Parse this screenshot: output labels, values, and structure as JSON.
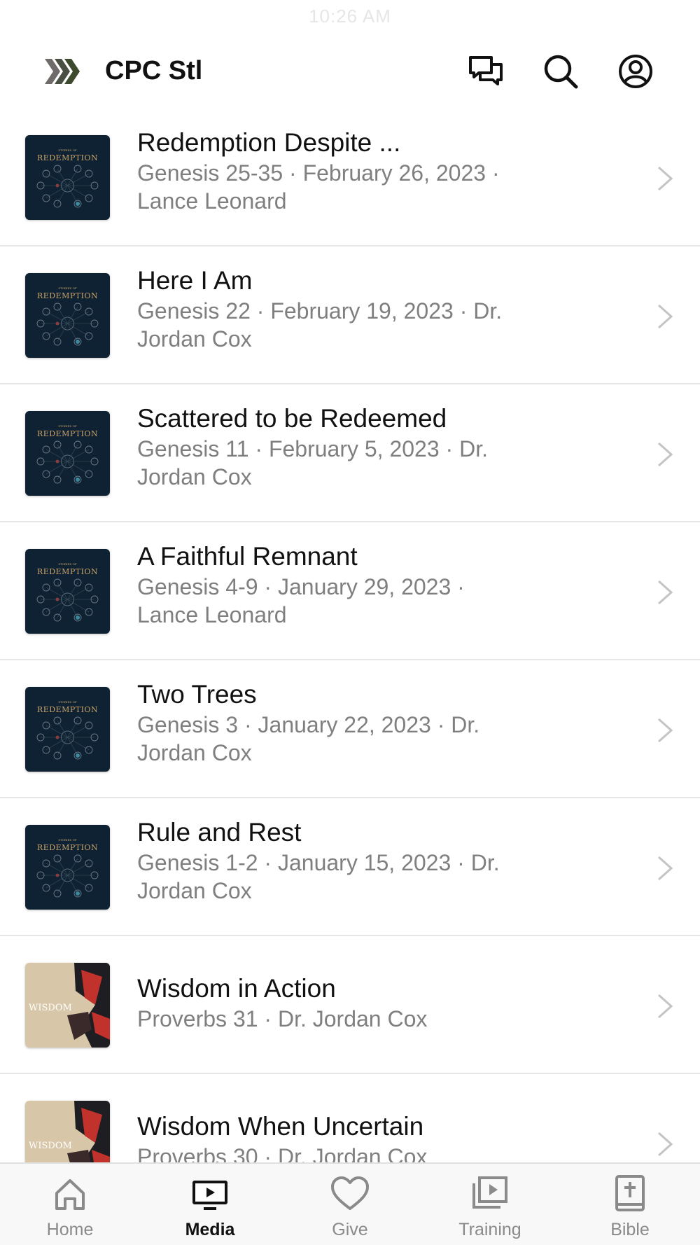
{
  "status_bar": {
    "time": "10:26 AM"
  },
  "header": {
    "title": "CPC Stl",
    "logo_icon": "chevron-logo-icon",
    "actions": [
      "chat-icon",
      "search-icon",
      "profile-icon"
    ]
  },
  "sermons": [
    {
      "title": "Redemption Despite ...",
      "meta_line1": "Genesis 25-35 · February 26, 2023 ·",
      "meta_line2": "Lance Leonard",
      "artwork": "redemption",
      "artwork_text": "REDEMPTION"
    },
    {
      "title": "Here I Am",
      "meta_line1": "Genesis 22 · February 19, 2023 · Dr.",
      "meta_line2": "Jordan Cox",
      "artwork": "redemption",
      "artwork_text": "REDEMPTION"
    },
    {
      "title": "Scattered to be Redeemed",
      "meta_line1": "Genesis 11 · February 5, 2023 · Dr.",
      "meta_line2": "Jordan Cox",
      "artwork": "redemption",
      "artwork_text": "REDEMPTION"
    },
    {
      "title": "A Faithful Remnant",
      "meta_line1": "Genesis 4-9 · January 29, 2023 ·",
      "meta_line2": "Lance Leonard",
      "artwork": "redemption",
      "artwork_text": "REDEMPTION"
    },
    {
      "title": "Two Trees",
      "meta_line1": "Genesis 3 · January 22, 2023 · Dr.",
      "meta_line2": "Jordan Cox",
      "artwork": "redemption",
      "artwork_text": "REDEMPTION"
    },
    {
      "title": "Rule and Rest",
      "meta_line1": "Genesis 1-2 · January 15, 2023 · Dr.",
      "meta_line2": "Jordan Cox",
      "artwork": "redemption",
      "artwork_text": "REDEMPTION"
    },
    {
      "title": "Wisdom in Action",
      "meta_line1": "Proverbs 31 · Dr. Jordan Cox",
      "meta_line2": "",
      "artwork": "wisdom",
      "artwork_text": "WISDOM"
    },
    {
      "title": "Wisdom When Uncertain",
      "meta_line1": "Proverbs 30 · Dr. Jordan Cox",
      "meta_line2": "",
      "artwork": "wisdom",
      "artwork_text": "WISDOM"
    }
  ],
  "tabs": [
    {
      "label": "Home",
      "icon": "home-icon",
      "active": false
    },
    {
      "label": "Media",
      "icon": "media-icon",
      "active": true
    },
    {
      "label": "Give",
      "icon": "heart-icon",
      "active": false
    },
    {
      "label": "Training",
      "icon": "training-icon",
      "active": false
    },
    {
      "label": "Bible",
      "icon": "bible-icon",
      "active": false
    }
  ],
  "colors": {
    "redemption_bg": "#0e2233",
    "redemption_gold": "#c9a46a",
    "wisdom_bg": "#d8c6a8",
    "wisdom_red": "#c0322b",
    "meta_text": "#7f7f7f",
    "chevron": "#c4c4c4"
  }
}
